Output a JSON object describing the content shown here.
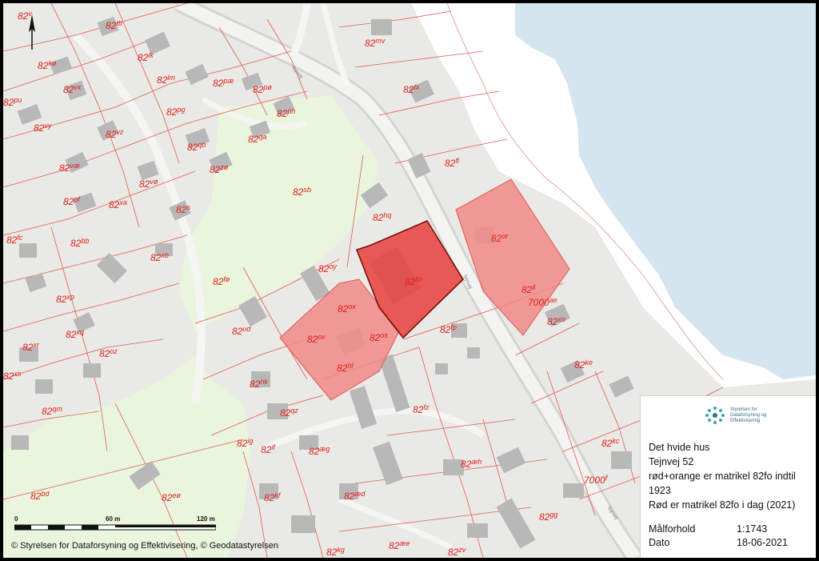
{
  "parcel_labels": [
    {
      "num": "82",
      "suffix": "v"
    },
    {
      "num": "82",
      "suffix": "tb"
    },
    {
      "num": "82",
      "suffix": "kø"
    },
    {
      "num": "82",
      "suffix": "lk"
    },
    {
      "num": "82",
      "suffix": "lm"
    },
    {
      "num": "82",
      "suffix": "pæ"
    },
    {
      "num": "82",
      "suffix": "pø"
    },
    {
      "num": "82",
      "suffix": "vx"
    },
    {
      "num": "82",
      "suffix": "pu"
    },
    {
      "num": "82",
      "suffix": "pg"
    },
    {
      "num": "82",
      "suffix": "ph"
    },
    {
      "num": "82",
      "suffix": "vy"
    },
    {
      "num": "82",
      "suffix": "vz"
    },
    {
      "num": "82",
      "suffix": "qb"
    },
    {
      "num": "82",
      "suffix": "qa"
    },
    {
      "num": "82",
      "suffix": "væ"
    },
    {
      "num": "82",
      "suffix": "vø"
    },
    {
      "num": "82",
      "suffix": "zø"
    },
    {
      "num": "82",
      "suffix": "pf"
    },
    {
      "num": "82",
      "suffix": "xa"
    },
    {
      "num": "82",
      "suffix": "s"
    },
    {
      "num": "82",
      "suffix": "sb"
    },
    {
      "num": "82",
      "suffix": "fc"
    },
    {
      "num": "82",
      "suffix": "bb"
    },
    {
      "num": "82",
      "suffix": "xb"
    },
    {
      "num": "82",
      "suffix": "mv"
    },
    {
      "num": "82",
      "suffix": "fx"
    },
    {
      "num": "82",
      "suffix": "fl"
    },
    {
      "num": "82",
      "suffix": "hq"
    },
    {
      "num": "82",
      "suffix": "or"
    },
    {
      "num": "82",
      "suffix": "oy"
    },
    {
      "num": "82",
      "suffix": "fo"
    },
    {
      "num": "82",
      "suffix": "fø"
    },
    {
      "num": "82",
      "suffix": "ox"
    },
    {
      "num": "82",
      "suffix": "il"
    },
    {
      "num": "7000",
      "suffix": "ae"
    },
    {
      "num": "82",
      "suffix": "xp"
    },
    {
      "num": "82",
      "suffix": "ud"
    },
    {
      "num": "82",
      "suffix": "ov"
    },
    {
      "num": "82",
      "suffix": "os"
    },
    {
      "num": "82",
      "suffix": "fp"
    },
    {
      "num": "82",
      "suffix": "xo"
    },
    {
      "num": "82",
      "suffix": "xq"
    },
    {
      "num": "82",
      "suffix": "xr"
    },
    {
      "num": "82",
      "suffix": "oz"
    },
    {
      "num": "82",
      "suffix": "hl"
    },
    {
      "num": "82",
      "suffix": "ke"
    },
    {
      "num": "82",
      "suffix": "xs"
    },
    {
      "num": "82",
      "suffix": "hk"
    },
    {
      "num": "82",
      "suffix": "qm"
    },
    {
      "num": "82",
      "suffix": "qz"
    },
    {
      "num": "82",
      "suffix": "fz"
    },
    {
      "num": "82",
      "suffix": "kc"
    },
    {
      "num": "82",
      "suffix": "ig"
    },
    {
      "num": "82",
      "suffix": "if"
    },
    {
      "num": "82",
      "suffix": "æg"
    },
    {
      "num": "82",
      "suffix": "æh"
    },
    {
      "num": "7000",
      "suffix": "f"
    },
    {
      "num": "82",
      "suffix": "bd"
    },
    {
      "num": "82",
      "suffix": "eø"
    },
    {
      "num": "82",
      "suffix": "kf"
    },
    {
      "num": "82",
      "suffix": "æd"
    },
    {
      "num": "82",
      "suffix": "gg"
    },
    {
      "num": "82",
      "suffix": "kg"
    },
    {
      "num": "82",
      "suffix": "æe"
    },
    {
      "num": "82",
      "suffix": "zv"
    }
  ],
  "road_labels": [
    "Tejnvej",
    "Tejnvej",
    "Tejnvej"
  ],
  "legend": {
    "logo_text": "Styrelsen for Dataforsyning og Effektivisering",
    "lines": [
      "Det hvide hus",
      "Tejnvej 52",
      "rød+orange er matrikel 82fo indtil",
      "1923",
      "Rød er matrikel 82fo i dag (2021)"
    ],
    "scale_label": "Målforhold",
    "scale_value": "1:1743",
    "date_label": "Dato",
    "date_value": "18-06-2021"
  },
  "scalebar": {
    "ticks": [
      "0",
      "60 m",
      "120 m"
    ],
    "total_meters": 120
  },
  "copyright": "© Styrelsen for Dataforsyning og Effektivisering, © Geodatastyrelsen",
  "colors": {
    "water": "#d5e5ef",
    "shore": "#ffffff",
    "ground": "#e9e9e6",
    "green": "#eaf5dd",
    "parcel_line": "#e25a56",
    "building": "#b8b8b8",
    "highlight_red": "#e8403c",
    "highlight_pink": "#f08a86"
  }
}
